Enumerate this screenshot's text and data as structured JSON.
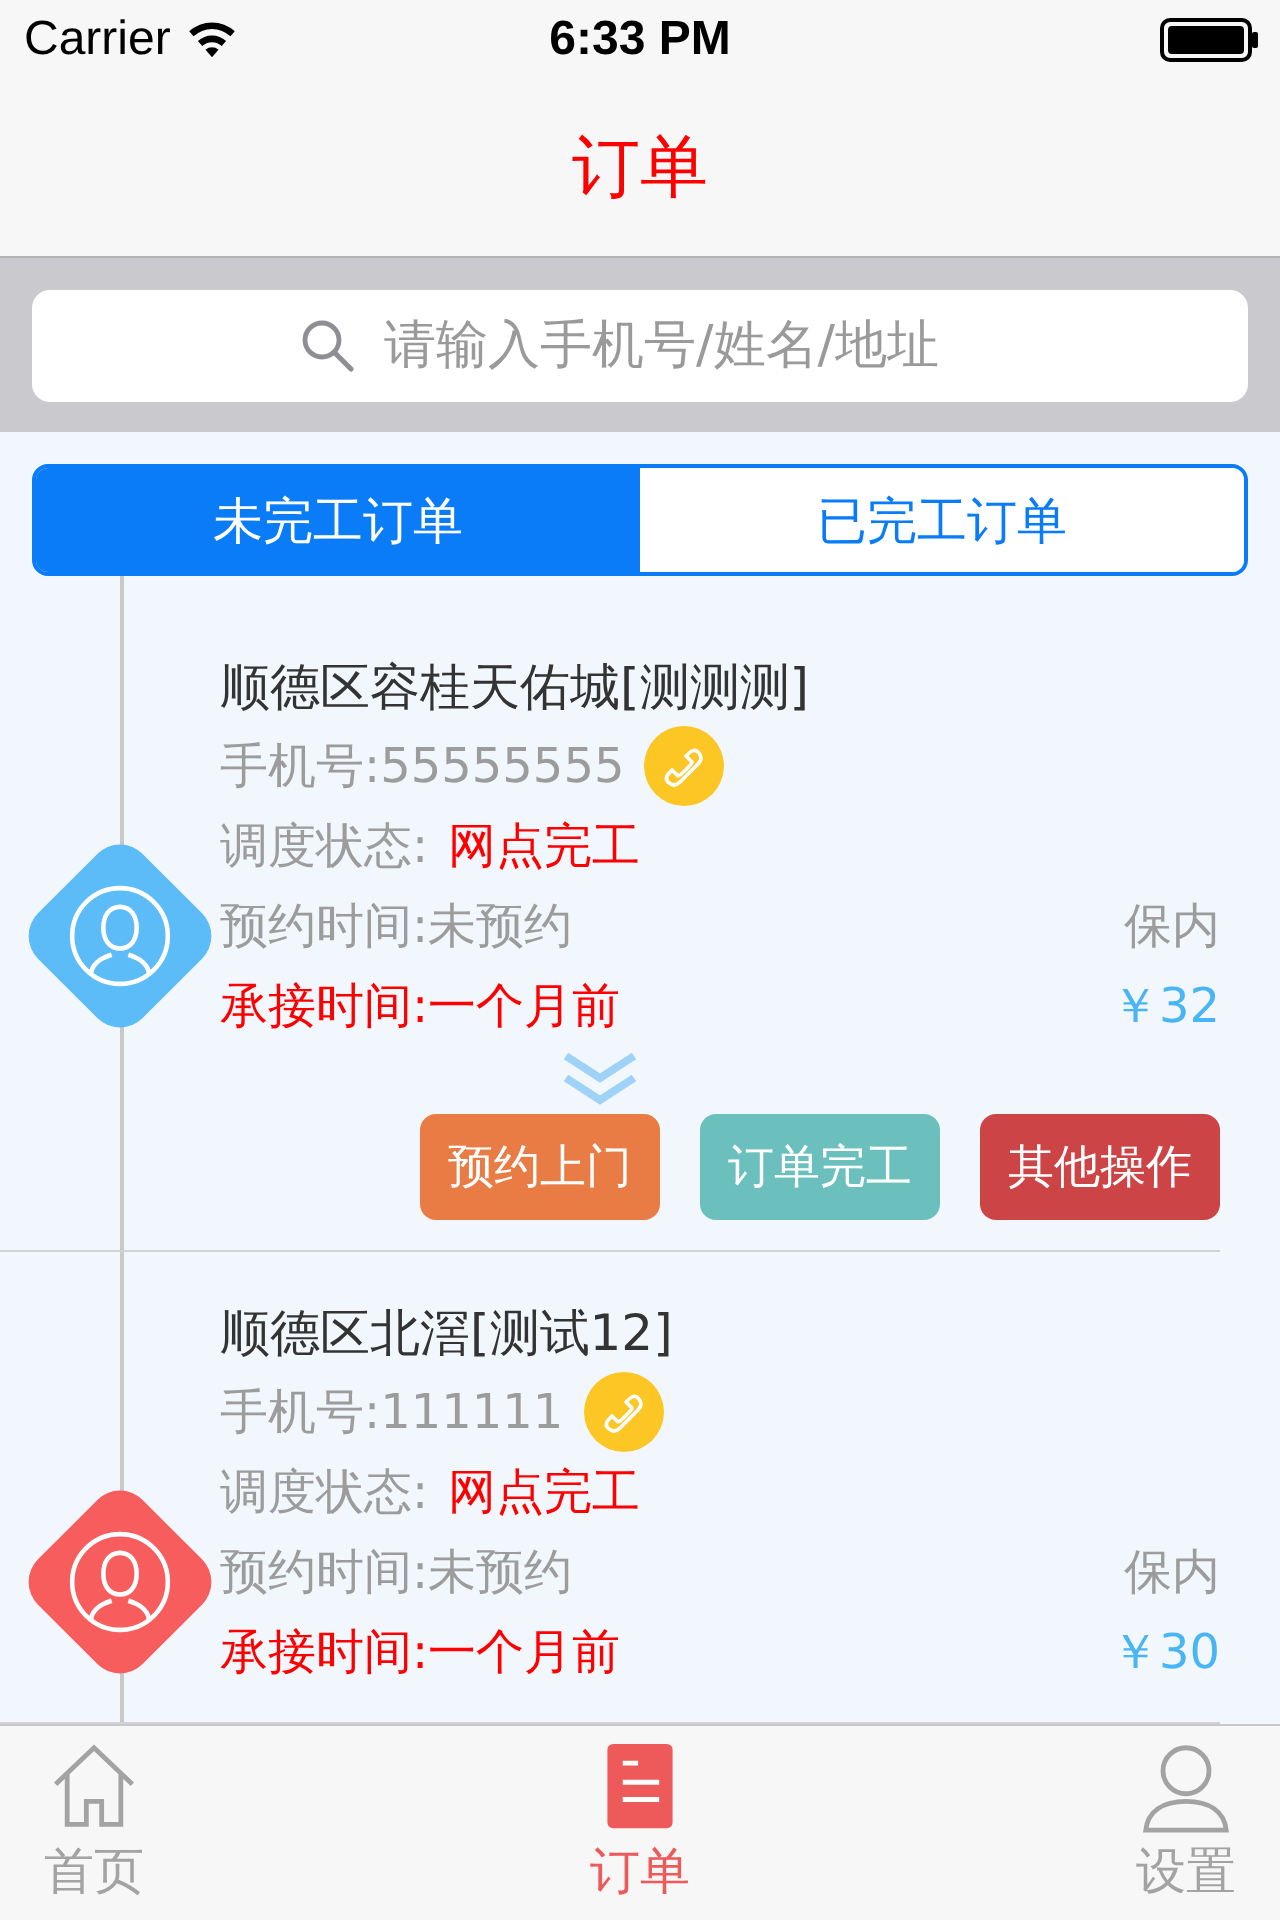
{
  "status_bar": {
    "carrier": "Carrier",
    "time": "6:33 PM"
  },
  "nav": {
    "title": "订单"
  },
  "search": {
    "placeholder": "请输入手机号/姓名/地址"
  },
  "segments": [
    {
      "label": "未完工订单",
      "selected": true
    },
    {
      "label": "已完工订单",
      "selected": false
    }
  ],
  "orders": [
    {
      "address": "顺德区容桂天佑城[测测测]",
      "phone": "手机号:55555555",
      "status_label": "调度状态:",
      "status_value": "网点完工",
      "appointment": "预约时间:未预约",
      "warranty": "保内",
      "accepted": "承接时间:一个月前",
      "price": "￥32",
      "color": "#5bbcf8",
      "buttons": [
        {
          "label": "预约上门",
          "color": "#e97c44"
        },
        {
          "label": "订单完工",
          "color": "#6bbfbd"
        },
        {
          "label": "其他操作",
          "color": "#cd4447"
        }
      ]
    },
    {
      "address": "顺德区北滘[测试12]",
      "phone": "手机号:111111",
      "status_label": "调度状态:",
      "status_value": "网点完工",
      "appointment": "预约时间:未预约",
      "warranty": "保内",
      "accepted": "承接时间:一个月前",
      "price": "￥30",
      "color": "#f85d5e"
    }
  ],
  "tab_bar": [
    {
      "label": "首页",
      "kind": "home",
      "selected": false
    },
    {
      "label": "订单",
      "kind": "orders",
      "selected": true
    },
    {
      "label": "设置",
      "kind": "settings",
      "selected": false
    }
  ]
}
